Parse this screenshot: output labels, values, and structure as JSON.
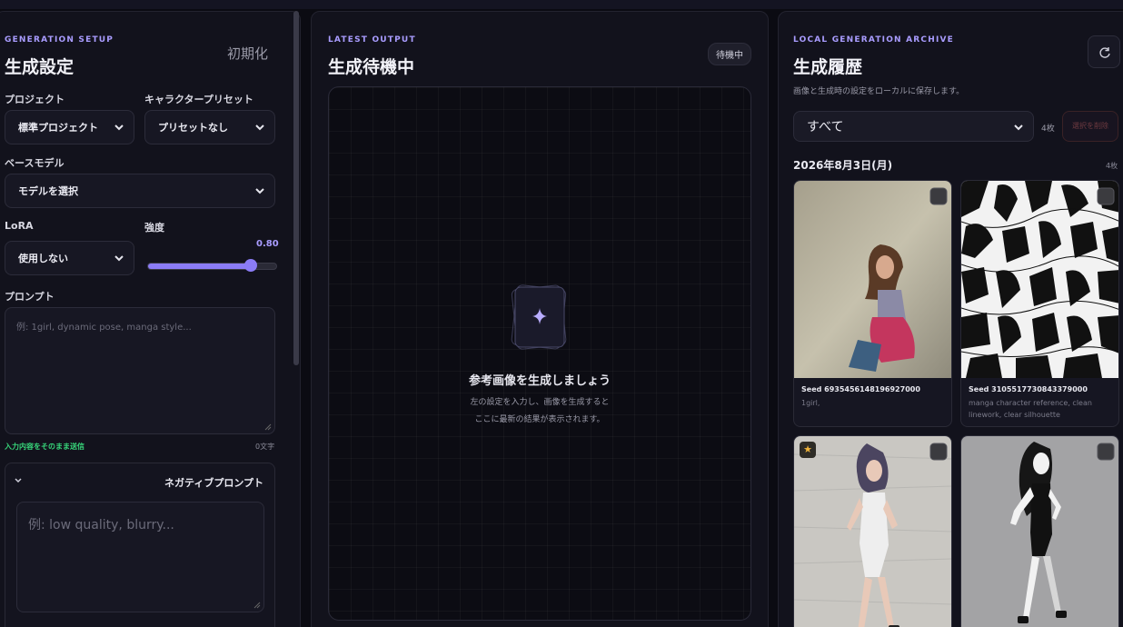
{
  "left": {
    "eyebrow": "GENERATION SETUP",
    "title": "生成設定",
    "reset": "初期化",
    "project_label": "プロジェクト",
    "project_value": "標準プロジェクト",
    "preset_label": "キャラクタープリセット",
    "preset_value": "プリセットなし",
    "model_label": "ベースモデル",
    "model_value": "モデルを選択",
    "lora_label": "LoRA",
    "lora_value": "使用しない",
    "strength_label": "強度",
    "strength_value": "0.80",
    "strength_level": 0.8,
    "prompt_label": "プロンプト",
    "prompt_placeholder": "例: 1girl, dynamic pose, manga style...",
    "send_raw": "入力内容をそのまま送信",
    "char_count": "0文字",
    "negative_label": "ネガティブプロンプト",
    "negative_placeholder": "例: low quality, blurry..."
  },
  "center": {
    "eyebrow": "LATEST OUTPUT",
    "title": "生成待機中",
    "status": "待機中",
    "empty_title": "参考画像を生成しましょう",
    "empty_line1": "左の設定を入力し、画像を生成すると",
    "empty_line2": "ここに最新の結果が表示されます。"
  },
  "right": {
    "eyebrow": "LOCAL GENERATION ARCHIVE",
    "title": "生成履歴",
    "subtitle": "画像と生成時の設定をローカルに保存します。",
    "filter_value": "すべて",
    "count": "4枚",
    "delete_selected": "選択を削除",
    "group_date": "2026年8月3日(月)",
    "group_count": "4枚",
    "cards": [
      {
        "seed": "Seed 6935456148196927000",
        "desc": "1girl,"
      },
      {
        "seed": "Seed 3105517730843379000",
        "desc": "manga character reference, clean linework, clear silhouette"
      }
    ]
  },
  "colors": {
    "accent": "#8b7cf6",
    "green": "#37d67a",
    "star": "#f2b53a"
  }
}
